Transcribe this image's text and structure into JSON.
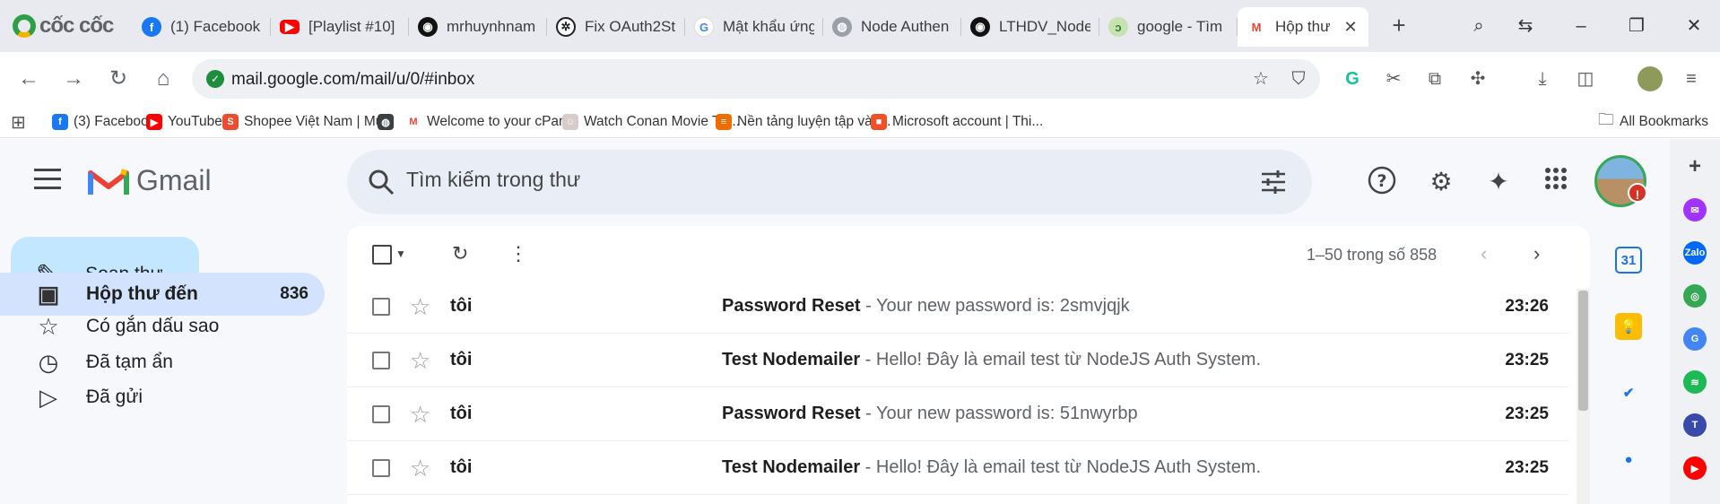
{
  "browser": {
    "brand": "cốc cốc",
    "tabs": [
      {
        "label": "(1) Facebook",
        "icon": "facebook-icon",
        "kind": "fb",
        "glyph": "f"
      },
      {
        "label": "[Playlist #10]",
        "icon": "youtube-icon",
        "kind": "yt",
        "glyph": "▶"
      },
      {
        "label": "mrhuynhnam",
        "icon": "github-icon",
        "kind": "gh",
        "glyph": "◉"
      },
      {
        "label": "Fix OAuth2St",
        "icon": "openai-icon",
        "kind": "oa",
        "glyph": "✲"
      },
      {
        "label": "Mật khẩu ứng",
        "icon": "google-icon",
        "kind": "g",
        "glyph": "G"
      },
      {
        "label": "Node Authen",
        "icon": "globe-icon",
        "kind": "gray",
        "glyph": "◍"
      },
      {
        "label": "LTHDV_Node",
        "icon": "github-icon",
        "kind": "gh",
        "glyph": "◉"
      },
      {
        "label": "google - Tìm",
        "icon": "coccoc-icon",
        "kind": "cc",
        "glyph": "ↄ"
      },
      {
        "label": "Hộp thư",
        "icon": "gmail-icon",
        "kind": "gm",
        "glyph": "M",
        "active": true
      }
    ],
    "url": "mail.google.com/mail/u/0/#inbox",
    "bookmarks": [
      {
        "label": "(3) Facebook",
        "icon": "facebook-icon",
        "color": "#1877f2",
        "glyph": "f"
      },
      {
        "label": "YouTube",
        "icon": "youtube-icon",
        "color": "#ff0000",
        "glyph": "▶"
      },
      {
        "label": "Shopee Việt Nam | Mu...",
        "icon": "shopee-icon",
        "color": "#ee4d2d",
        "glyph": "S"
      },
      {
        "label": "",
        "icon": "globe-icon",
        "color": "#3c4043",
        "glyph": "◍"
      },
      {
        "label": "Welcome to your cPan...",
        "icon": "gmail-icon",
        "color": "#ffffff",
        "glyph": "M"
      },
      {
        "label": "Watch Conan Movie Tậ...",
        "icon": "conan-icon",
        "color": "#d7ccc8",
        "glyph": "☺"
      },
      {
        "label": "Nền tảng luyện tập và l...",
        "icon": "stack-icon",
        "color": "#ef6c00",
        "glyph": "≡"
      },
      {
        "label": "Microsoft account | Thi...",
        "icon": "microsoft-icon",
        "color": "#f25022",
        "glyph": "■"
      }
    ],
    "all_bookmarks": "All Bookmarks"
  },
  "gmail": {
    "product_name": "Gmail",
    "search_placeholder": "Tìm kiếm trong thư",
    "compose_label": "Soạn thư",
    "nav": [
      {
        "label": "Hộp thư đến",
        "count": "836",
        "icon": "inbox-icon",
        "active": true
      },
      {
        "label": "Có gắn dấu sao",
        "count": "",
        "icon": "star-icon"
      },
      {
        "label": "Đã tạm ẩn",
        "count": "",
        "icon": "clock-icon"
      },
      {
        "label": "Đã gửi",
        "count": "",
        "icon": "send-icon"
      }
    ],
    "pagination": "1–50 trong số 858",
    "emails": [
      {
        "sender": "tôi",
        "subject": "Password Reset",
        "snippet": "Your new password is: 2smvjqjk",
        "time": "23:26"
      },
      {
        "sender": "tôi",
        "subject": "Test Nodemailer",
        "snippet": "Hello! Đây là email test từ NodeJS Auth System.",
        "time": "23:25"
      },
      {
        "sender": "tôi",
        "subject": "Password Reset",
        "snippet": "Your new password is: 51nwyrbp",
        "time": "23:25"
      },
      {
        "sender": "tôi",
        "subject": "Test Nodemailer",
        "snippet": "Hello! Đây là email test từ NodeJS Auth System.",
        "time": "23:25"
      }
    ],
    "side_panel": [
      {
        "icon": "calendar-icon",
        "glyph": "31",
        "color": "#1a73e8"
      },
      {
        "icon": "keep-icon",
        "glyph": "💡",
        "color": "#fbbc04"
      },
      {
        "icon": "tasks-icon",
        "glyph": "✔",
        "color": "#1a73e8"
      },
      {
        "icon": "contacts-icon",
        "glyph": "●",
        "color": "#1a73e8"
      }
    ]
  },
  "browser_sidebar": [
    {
      "icon": "add-icon",
      "glyph": "+",
      "color": "#f0f1f5"
    },
    {
      "icon": "messenger-icon",
      "glyph": "✉",
      "color": "#a033ff"
    },
    {
      "icon": "zalo-icon",
      "glyph": "Zalo",
      "color": "#0068ff"
    },
    {
      "icon": "game-icon",
      "glyph": "◎",
      "color": "#34a853"
    },
    {
      "icon": "translate-icon",
      "glyph": "G",
      "color": "#4285f4"
    },
    {
      "icon": "spotify-icon",
      "glyph": "≋",
      "color": "#1db954"
    },
    {
      "icon": "telegram-icon",
      "glyph": "T",
      "color": "#3949ab"
    },
    {
      "icon": "youtube-icon",
      "glyph": "▶",
      "color": "#ff0000"
    }
  ]
}
